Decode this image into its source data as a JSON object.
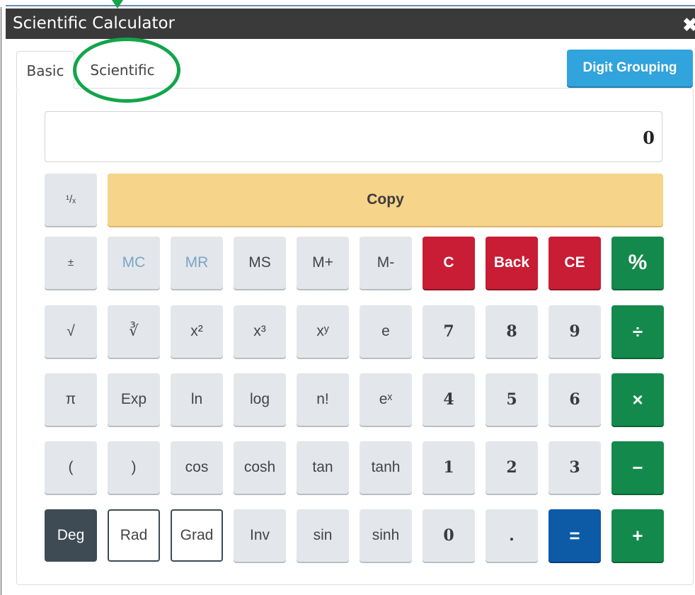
{
  "window": {
    "title": "Scientific Calculator",
    "close_label": "✖"
  },
  "tabs": [
    {
      "label": "Basic"
    },
    {
      "label": "Scientific"
    }
  ],
  "digit_grouping_label": "Digit Grouping",
  "display": {
    "value": "0"
  },
  "reciprocal_label": "¹/ₓ",
  "copy_label": "Copy",
  "rows": {
    "r1": [
      "±",
      "MC",
      "MR",
      "MS",
      "M+",
      "M-",
      "C",
      "Back",
      "CE",
      "%"
    ],
    "r2": [
      "√",
      "∛",
      "x²",
      "x³",
      "xʸ",
      "e",
      "7",
      "8",
      "9",
      "÷"
    ],
    "r3": [
      "π",
      "Exp",
      "ln",
      "log",
      "n!",
      "eˣ",
      "4",
      "5",
      "6",
      "×"
    ],
    "r4": [
      "(",
      ")",
      "cos",
      "cosh",
      "tan",
      "tanh",
      "1",
      "2",
      "3",
      "−"
    ],
    "r5": [
      "Deg",
      "Rad",
      "Grad",
      "Inv",
      "sin",
      "sinh",
      "0",
      ".",
      "=",
      "+"
    ]
  },
  "colors": {
    "titlebar": "#3a3a3a",
    "digit_grouping": "#31a3dd",
    "copy": "#f6d48a",
    "red": "#c81d35",
    "green": "#138a4b",
    "blue": "#0d5aa7",
    "highlight_circle": "#12a54a"
  }
}
